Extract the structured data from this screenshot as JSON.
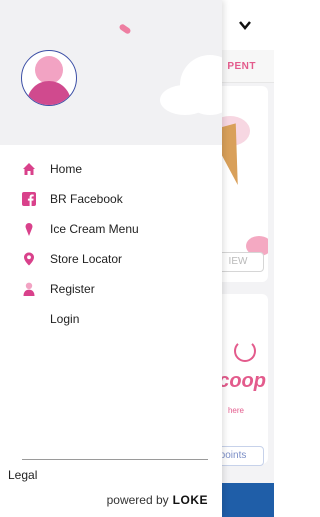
{
  "background": {
    "tab_label": "PENT",
    "button1_label": "IEW",
    "scoop_text": "coop",
    "scoop_subtext": "here",
    "button2_label": "points"
  },
  "drawer": {
    "menu": [
      {
        "label": "Home",
        "icon": "home-icon",
        "icon_color": "#d9418b"
      },
      {
        "label": "BR Facebook",
        "icon": "facebook-icon",
        "icon_color": "#d9418b"
      },
      {
        "label": "Ice Cream Menu",
        "icon": "ice-cream-icon",
        "icon_color": "#d9418b"
      },
      {
        "label": "Store Locator",
        "icon": "location-pin-icon",
        "icon_color": "#d9418b"
      },
      {
        "label": "Register",
        "icon": "person-icon",
        "icon_color": "#d9418b"
      },
      {
        "label": "Login",
        "icon": "",
        "icon_color": "#d9418b"
      }
    ],
    "legal_label": "Legal",
    "powered_by_label": "powered by",
    "powered_by_brand": "LOKE"
  },
  "colors": {
    "accent_pink": "#d9418b",
    "header_bg": "#f1f1f3",
    "brand_blue": "#1f5ea8"
  }
}
